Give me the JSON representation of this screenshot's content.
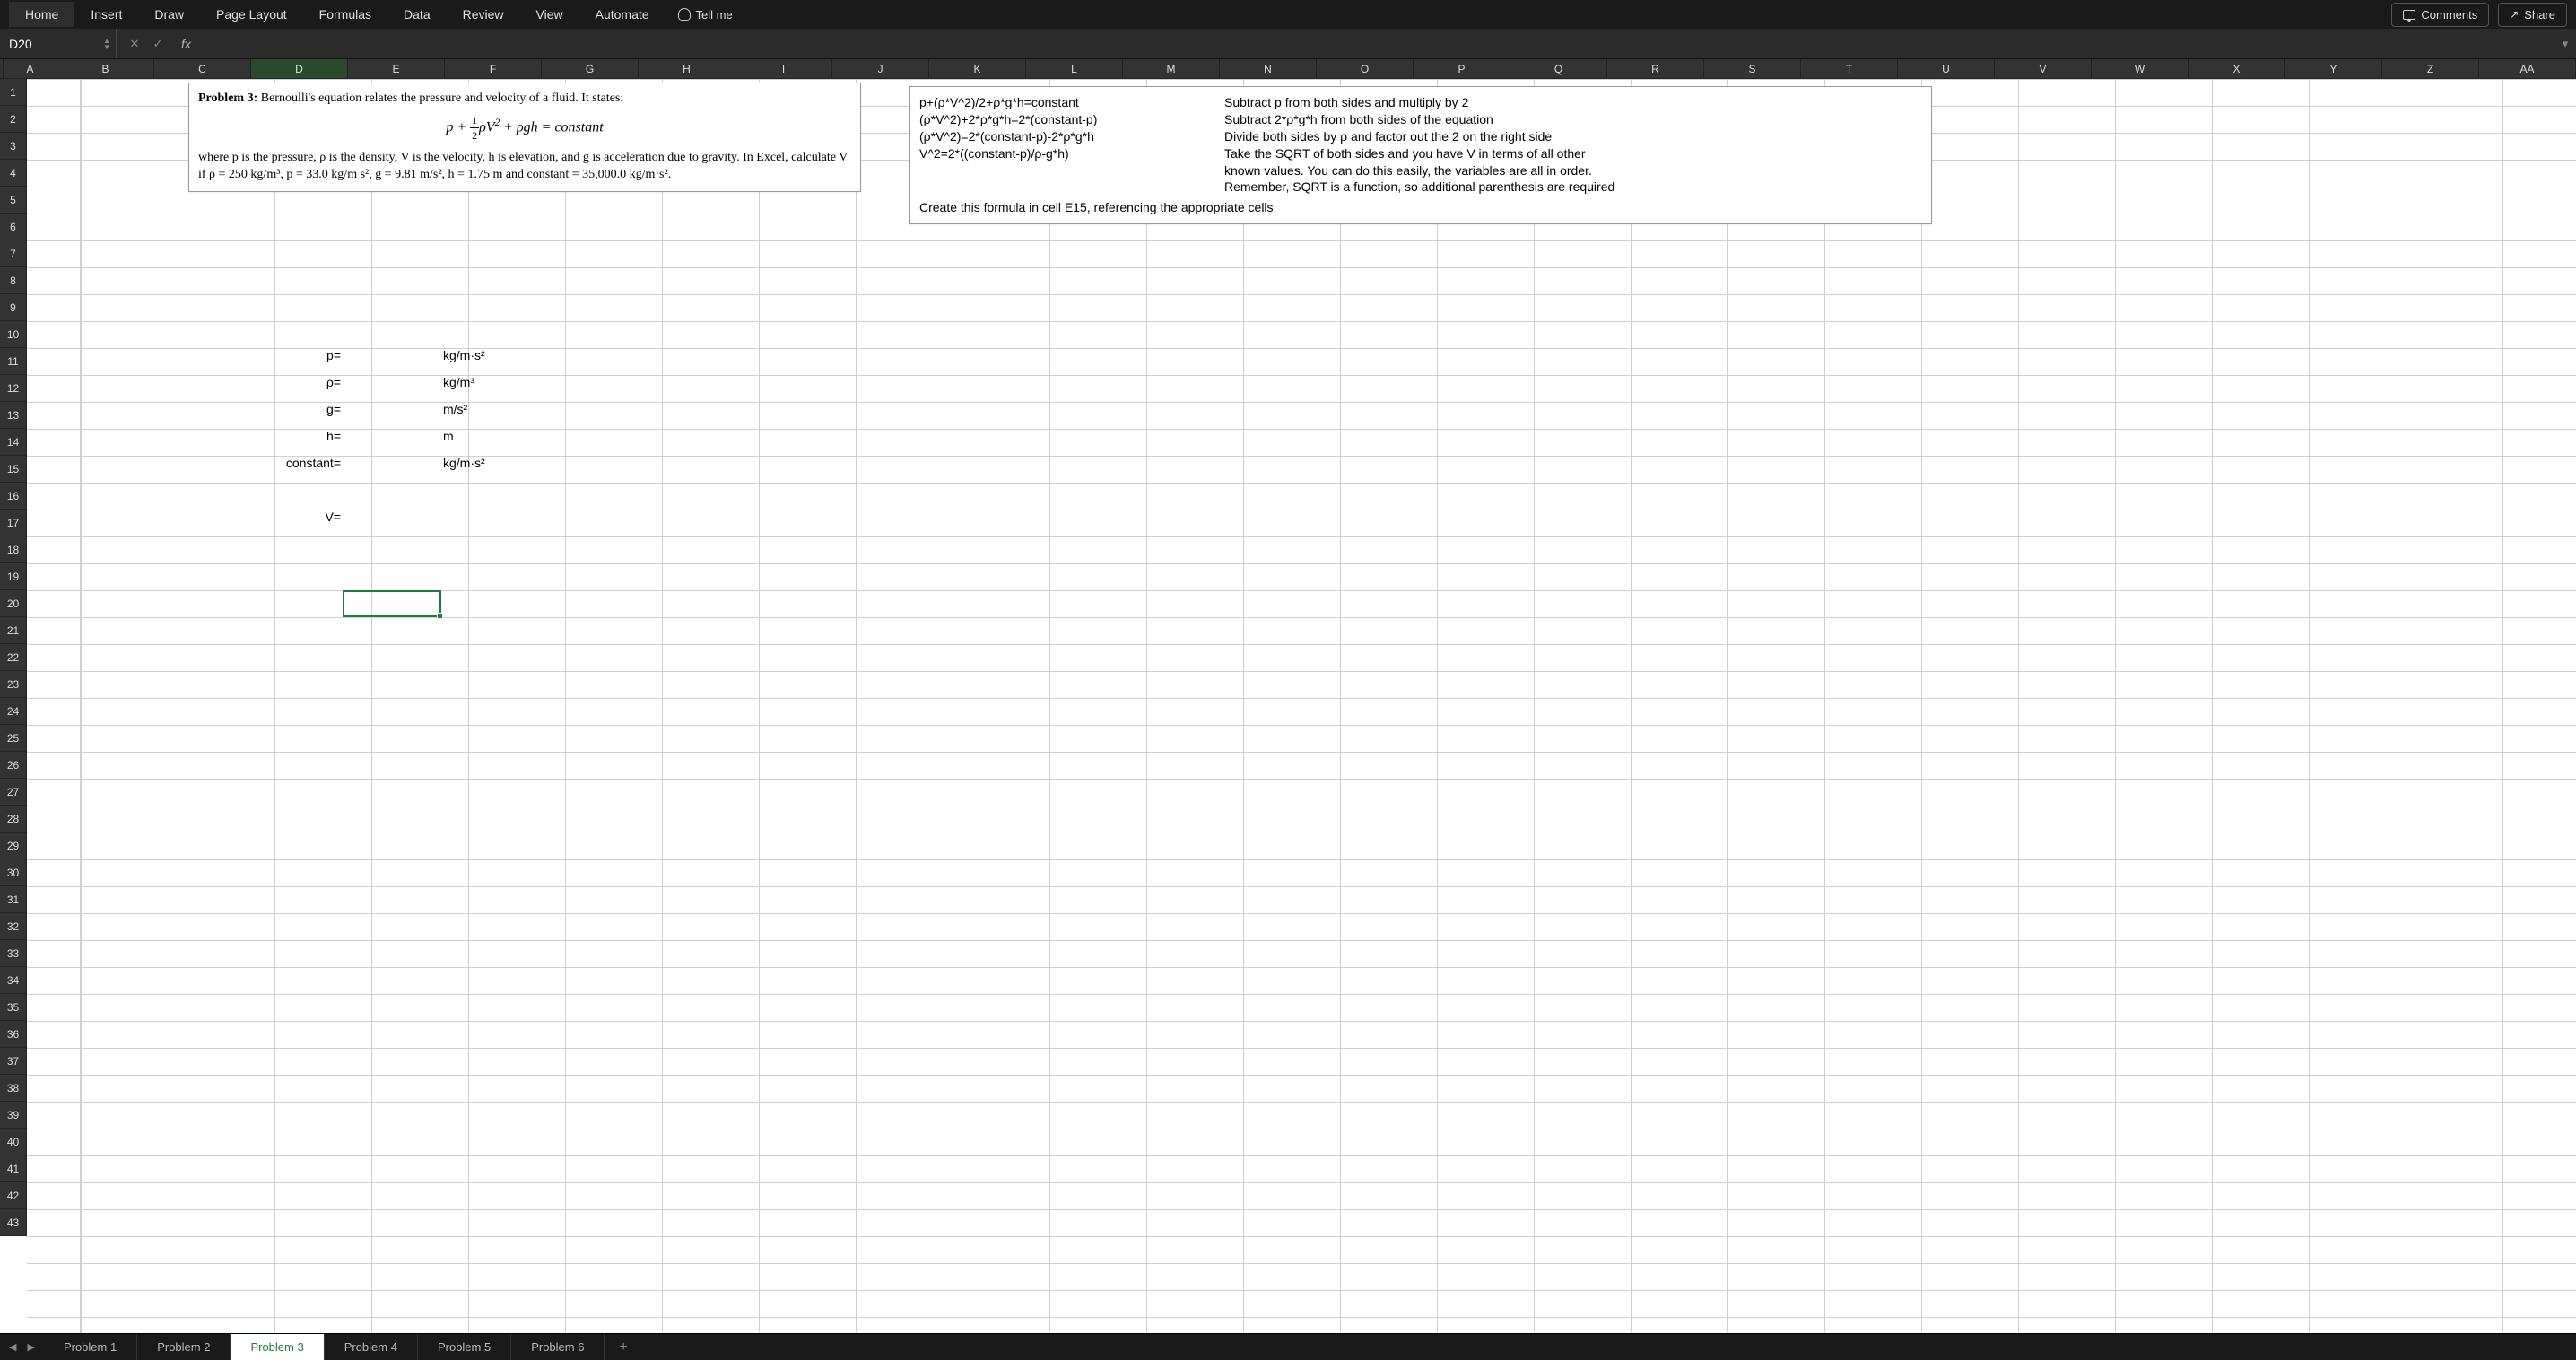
{
  "ribbon": {
    "tabs": [
      "Home",
      "Insert",
      "Draw",
      "Page Layout",
      "Formulas",
      "Data",
      "Review",
      "View",
      "Automate"
    ],
    "tellme": "Tell me",
    "comments": "Comments",
    "share": "Share"
  },
  "formula_bar": {
    "name_box": "D20",
    "fx": "fx",
    "value": ""
  },
  "columns": [
    "A",
    "B",
    "C",
    "D",
    "E",
    "F",
    "G",
    "H",
    "I",
    "J",
    "K",
    "L",
    "M",
    "N",
    "O",
    "P",
    "Q",
    "R",
    "S",
    "T",
    "U",
    "V",
    "W",
    "X",
    "Y",
    "Z",
    "AA"
  ],
  "row_count": 43,
  "selection": {
    "cell": "D20",
    "col_index": 3,
    "row_index": 19
  },
  "problem_box": {
    "title": "Problem 3:",
    "intro": " Bernoulli's equation relates the pressure and velocity of a fluid.  It states:",
    "equation_html": "p + <span class='frac'><span class='n'>1</span><span class='d'>2</span></span>ρV<sup>2</sup> + ρgh = constant",
    "body": "where p is the pressure, ρ is the density, V is the velocity, h is elevation, and g is acceleration due to gravity. In Excel, calculate V if ρ = 250 kg/m³, p = 33.0 kg/m s², g = 9.81 m/s², h = 1.75 m and constant = 35,000.0 kg/m·s²."
  },
  "hint_box": {
    "lines": [
      {
        "eq": "p+(ρ*V^2)/2+ρ*g*h=constant",
        "note": "Subtract p from both sides and multiply by 2"
      },
      {
        "eq": "(ρ*V^2)+2*ρ*g*h=2*(constant-p)",
        "note": "Subtract 2*ρ*g*h from both sides of the equation"
      },
      {
        "eq": "(ρ*V^2)=2*(constant-p)-2*ρ*g*h",
        "note": "Divide both sides by ρ and factor out the 2 on the right side"
      },
      {
        "eq": "V^2=2*((constant-p)/ρ-g*h)",
        "note": "Take the SQRT of both sides and you have V in terms of all other"
      },
      {
        "eq": "",
        "note": "known values.  You can do this easily, the variables are all in order."
      },
      {
        "eq": "",
        "note": "Remember, SQRT is a function, so additional parenthesis are required"
      }
    ],
    "footer": "Create this formula in cell E15, referencing the appropriate cells"
  },
  "labels": {
    "p": "p=",
    "rho": "ρ=",
    "g": "g=",
    "h": "h=",
    "constant": "constant=",
    "V": "V="
  },
  "units": {
    "p": "kg/m·s²",
    "rho": "kg/m³",
    "g": "m/s²",
    "h": "m",
    "constant": "kg/m·s²"
  },
  "sheets": {
    "tabs": [
      "Problem 1",
      "Problem 2",
      "Problem 3",
      "Problem 4",
      "Problem 5",
      "Problem 6"
    ],
    "active": 2
  }
}
